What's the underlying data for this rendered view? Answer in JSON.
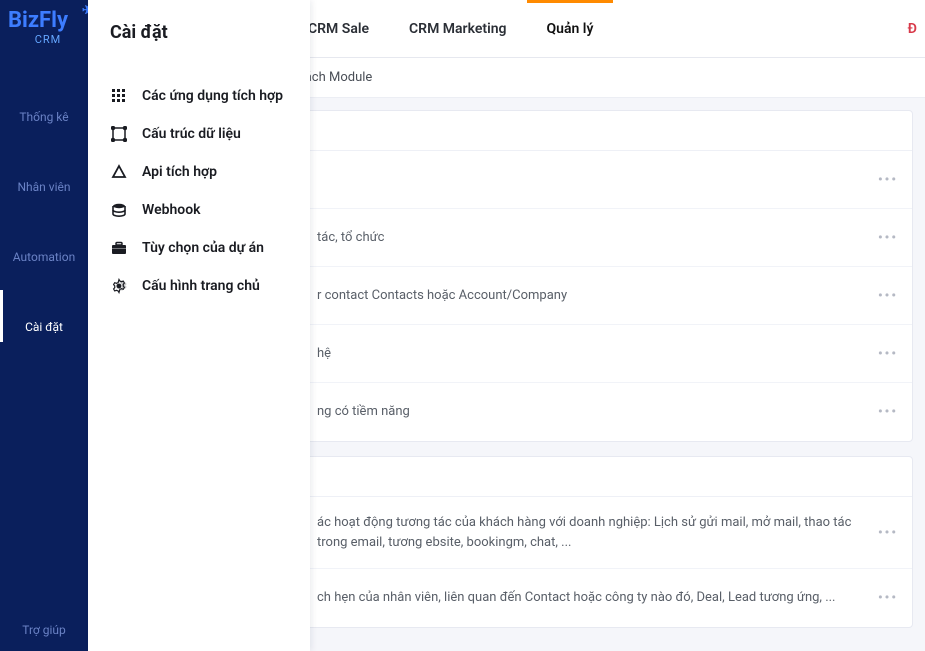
{
  "brand": {
    "name": "BizFly",
    "sub": "CRM"
  },
  "sidebar": {
    "items": [
      {
        "label": "Thống kê"
      },
      {
        "label": "Nhân viên"
      },
      {
        "label": "Automation"
      },
      {
        "label": "Cài đặt"
      }
    ],
    "help": "Trợ giúp"
  },
  "tabs": {
    "sale": "CRM Sale",
    "marketing": "CRM Marketing",
    "manage": "Quản lý"
  },
  "topbar_right": "Đ",
  "breadcrumb": "sách Module",
  "flyout": {
    "title": "Cài đặt",
    "items": [
      "Các ứng dụng tích hợp",
      "Cấu trúc dữ liệu",
      "Api tích hợp",
      "Webhook",
      "Tùy chọn của dự án",
      "Cấu hình trang chủ"
    ]
  },
  "modules_a": [
    {
      "desc": ""
    },
    {
      "desc": "tác, tổ chức"
    },
    {
      "desc": "r contact Contacts hoặc Account/Company"
    },
    {
      "desc": "hệ"
    },
    {
      "desc": "ng có tiềm năng"
    }
  ],
  "modules_b": [
    {
      "desc": "ác hoạt động tương tác của khách hàng với doanh nghiệp: Lịch sử gửi mail, mở mail, thao tác trong email, tương ebsite, bookingm, chat, ..."
    },
    {
      "desc": "ch hẹn của nhân viên, liên quan đến Contact hoặc công ty nào đó, Deal, Lead tương ứng, ..."
    }
  ],
  "more": "•••"
}
